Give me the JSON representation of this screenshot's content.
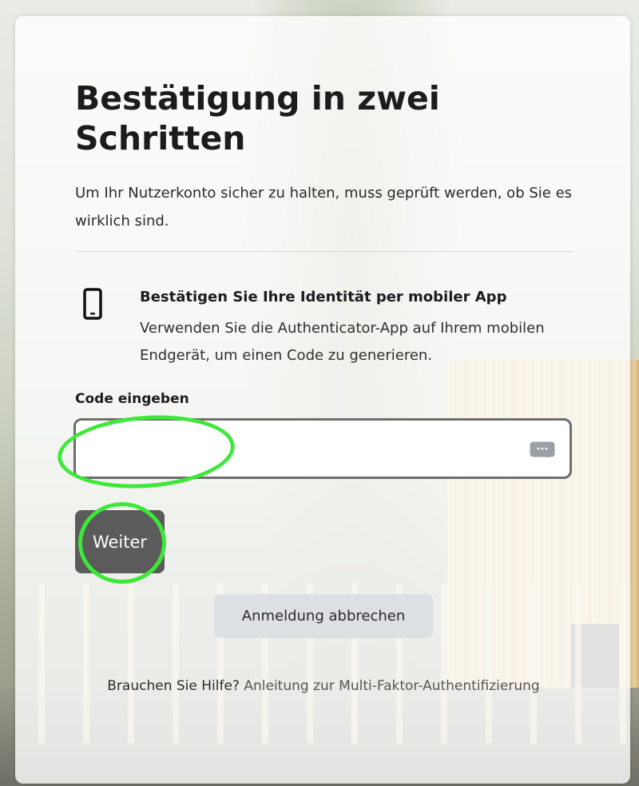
{
  "header": {
    "title": "Bestätigung in zwei Schritten",
    "subtitle": "Um Ihr Nutzerkonto sicher zu halten, muss geprüft werden, ob Sie es wirklich sind."
  },
  "method": {
    "icon": "mobile-phone-icon",
    "title": "Bestätigen Sie Ihre Identität per mobiler App",
    "description": "Verwenden Sie die Authenticator-App auf Ihrem mobilen Endgerät, um einen Code zu generieren."
  },
  "code": {
    "label": "Code eingeben",
    "value": "",
    "placeholder": "",
    "icon": "keyboard-icon"
  },
  "actions": {
    "next_label": "Weiter",
    "cancel_label": "Anmeldung abbrechen"
  },
  "help": {
    "question": "Brauchen Sie Hilfe?",
    "link_text": "Anleitung zur Multi-Faktor-Authentifizierung"
  },
  "colors": {
    "primary_button": "#5b5b5b",
    "secondary_button": "#dcdfe3",
    "annotation": "#3ee83a"
  }
}
